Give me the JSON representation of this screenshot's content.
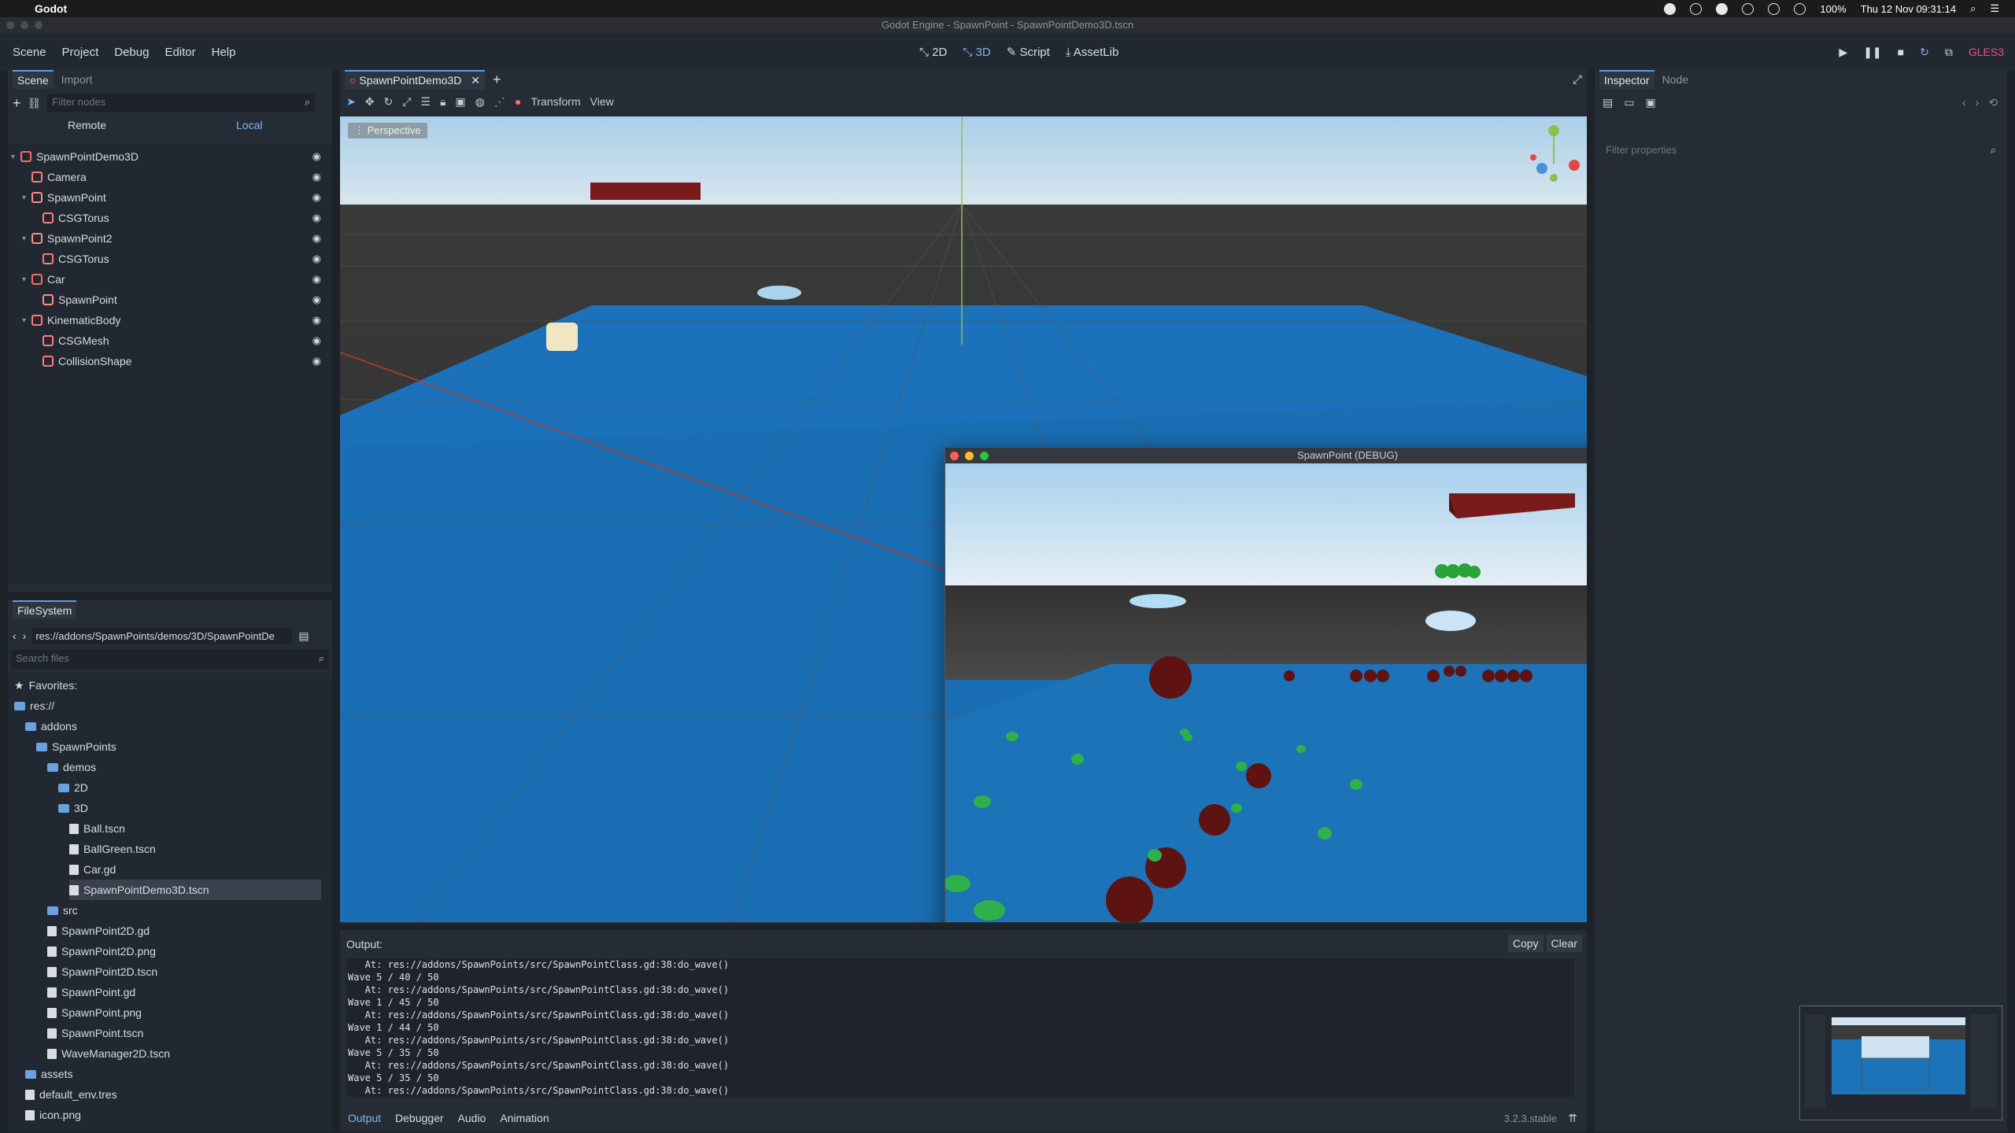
{
  "menubar": {
    "app_name": "Godot",
    "battery": "100%",
    "datetime": "Thu 12 Nov  09:31:14"
  },
  "window": {
    "title": "Godot Engine - SpawnPoint - SpawnPointDemo3D.tscn"
  },
  "editor_menu": [
    "Scene",
    "Project",
    "Debug",
    "Editor",
    "Help"
  ],
  "modes": [
    "2D",
    "3D",
    "Script",
    "AssetLib"
  ],
  "renderer": "GLES3",
  "scene_dock": {
    "tabs": [
      "Scene",
      "Import"
    ],
    "filter_placeholder": "Filter nodes",
    "remote": "Remote",
    "local": "Local",
    "nodes": [
      {
        "label": "SpawnPointDemo3D",
        "color": "#ff6a6a",
        "depth": 0,
        "arrow": "⌄"
      },
      {
        "label": "Camera",
        "color": "#ff7a7a",
        "depth": 1,
        "arrow": ""
      },
      {
        "label": "SpawnPoint",
        "color": "#ff8a8a",
        "depth": 1,
        "arrow": "⌄"
      },
      {
        "label": "CSGTorus",
        "color": "#ff7a7a",
        "depth": 2,
        "arrow": ""
      },
      {
        "label": "SpawnPoint2",
        "color": "#ff8a8a",
        "depth": 1,
        "arrow": "⌄"
      },
      {
        "label": "CSGTorus",
        "color": "#ff7a7a",
        "depth": 2,
        "arrow": ""
      },
      {
        "label": "Car",
        "color": "#ff6a6a",
        "depth": 1,
        "arrow": "⌄"
      },
      {
        "label": "SpawnPoint",
        "color": "#ff8a8a",
        "depth": 2,
        "arrow": ""
      },
      {
        "label": "KinematicBody",
        "color": "#ff7a7a",
        "depth": 1,
        "arrow": "⌄"
      },
      {
        "label": "CSGMesh",
        "color": "#ff7a7a",
        "depth": 2,
        "arrow": ""
      },
      {
        "label": "CollisionShape",
        "color": "#ff7a7a",
        "depth": 2,
        "arrow": ""
      }
    ]
  },
  "filesystem": {
    "title": "FileSystem",
    "path": "res://addons/SpawnPoints/demos/3D/SpawnPointDe",
    "search_placeholder": "Search files",
    "items": [
      {
        "label": "Favorites:",
        "type": "star",
        "depth": 0
      },
      {
        "label": "res://",
        "type": "folder",
        "depth": 0
      },
      {
        "label": "addons",
        "type": "folder",
        "depth": 1
      },
      {
        "label": "SpawnPoints",
        "type": "folder",
        "depth": 2
      },
      {
        "label": "demos",
        "type": "folder",
        "depth": 3
      },
      {
        "label": "2D",
        "type": "folder",
        "depth": 4
      },
      {
        "label": "3D",
        "type": "folder",
        "depth": 4
      },
      {
        "label": "Ball.tscn",
        "type": "file",
        "depth": 5
      },
      {
        "label": "BallGreen.tscn",
        "type": "file",
        "depth": 5
      },
      {
        "label": "Car.gd",
        "type": "file",
        "depth": 5
      },
      {
        "label": "SpawnPointDemo3D.tscn",
        "type": "file",
        "depth": 5,
        "selected": true
      },
      {
        "label": "src",
        "type": "folder",
        "depth": 3
      },
      {
        "label": "SpawnPoint2D.gd",
        "type": "file",
        "depth": 3
      },
      {
        "label": "SpawnPoint2D.png",
        "type": "file",
        "depth": 3
      },
      {
        "label": "SpawnPoint2D.tscn",
        "type": "file",
        "depth": 3
      },
      {
        "label": "SpawnPoint.gd",
        "type": "file",
        "depth": 3
      },
      {
        "label": "SpawnPoint.png",
        "type": "file",
        "depth": 3
      },
      {
        "label": "SpawnPoint.tscn",
        "type": "file",
        "depth": 3
      },
      {
        "label": "WaveManager2D.tscn",
        "type": "file",
        "depth": 3
      },
      {
        "label": "assets",
        "type": "folder",
        "depth": 1
      },
      {
        "label": "default_env.tres",
        "type": "file",
        "depth": 1
      },
      {
        "label": "icon.png",
        "type": "file",
        "depth": 1
      }
    ]
  },
  "viewport": {
    "tab": "SpawnPointDemo3D",
    "toolbar": [
      "Transform",
      "View"
    ],
    "perspective": "Perspective"
  },
  "game_window": {
    "title": "SpawnPoint (DEBUG)"
  },
  "output": {
    "label": "Output:",
    "copy": "Copy",
    "clear": "Clear",
    "lines": [
      "   At: res://addons/SpawnPoints/src/SpawnPointClass.gd:38:do_wave()",
      "Wave 5 / 40 / 50",
      "   At: res://addons/SpawnPoints/src/SpawnPointClass.gd:38:do_wave()",
      "Wave 1 / 45 / 50",
      "   At: res://addons/SpawnPoints/src/SpawnPointClass.gd:38:do_wave()",
      "Wave 1 / 44 / 50",
      "   At: res://addons/SpawnPoints/src/SpawnPointClass.gd:38:do_wave()",
      "Wave 5 / 35 / 50",
      "   At: res://addons/SpawnPoints/src/SpawnPointClass.gd:38:do_wave()",
      "Wave 5 / 35 / 50",
      "   At: res://addons/SpawnPoints/src/SpawnPointClass.gd:38:do_wave()"
    ],
    "bottom_tabs": [
      "Output",
      "Debugger",
      "Audio",
      "Animation"
    ],
    "version": "3.2.3.stable"
  },
  "inspector": {
    "tabs": [
      "Inspector",
      "Node"
    ],
    "filter_placeholder": "Filter properties"
  }
}
